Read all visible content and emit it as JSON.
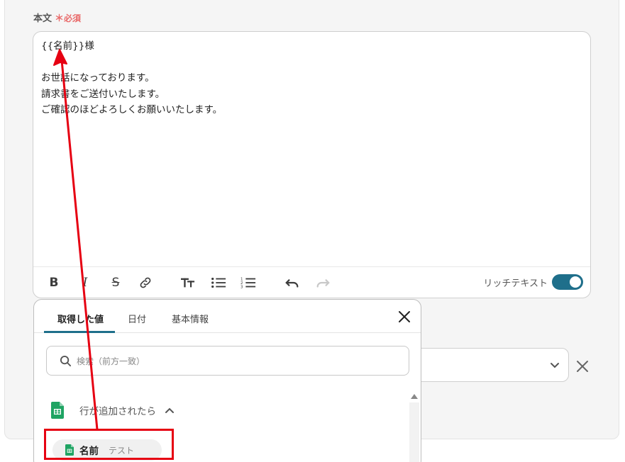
{
  "form": {
    "field_label": "本文",
    "required_star": "＊",
    "required_label": "必須"
  },
  "editor": {
    "lines": [
      "{{名前}}様",
      "",
      "お世話になっております。",
      "請求書をご送付いたします。",
      "ご確認のほどよろしくお願いいたします。"
    ],
    "toolbar": {
      "bold": "B",
      "italic": "I",
      "strike": "S",
      "rich_text_label": "リッチテキスト",
      "rich_text_enabled": true
    }
  },
  "popup": {
    "tabs": [
      {
        "label": "取得した値",
        "active": true
      },
      {
        "label": "日付",
        "active": false
      },
      {
        "label": "基本情報",
        "active": false
      }
    ],
    "search_placeholder": "検索（前方一致）",
    "group": {
      "title": "行が追加されたら",
      "icon": "google-sheets-icon",
      "expanded": true,
      "items": [
        {
          "name": "名前",
          "value": "テスト",
          "icon": "google-sheets-icon"
        }
      ]
    }
  },
  "colors": {
    "accent": "#1f6f8b",
    "required": "#e96a6a",
    "sheets_green": "#1fa463",
    "annotation_red": "#e60012"
  },
  "icons": {
    "link": "link-icon",
    "text_size": "text-size-icon",
    "bullet_list": "bullet-list-icon",
    "numbered_list": "numbered-list-icon",
    "undo": "undo-icon",
    "redo": "redo-icon",
    "close": "close-icon",
    "search": "search-icon",
    "chevron_down": "chevron-down-icon",
    "chevron_up": "chevron-up-icon",
    "clear": "clear-icon"
  }
}
